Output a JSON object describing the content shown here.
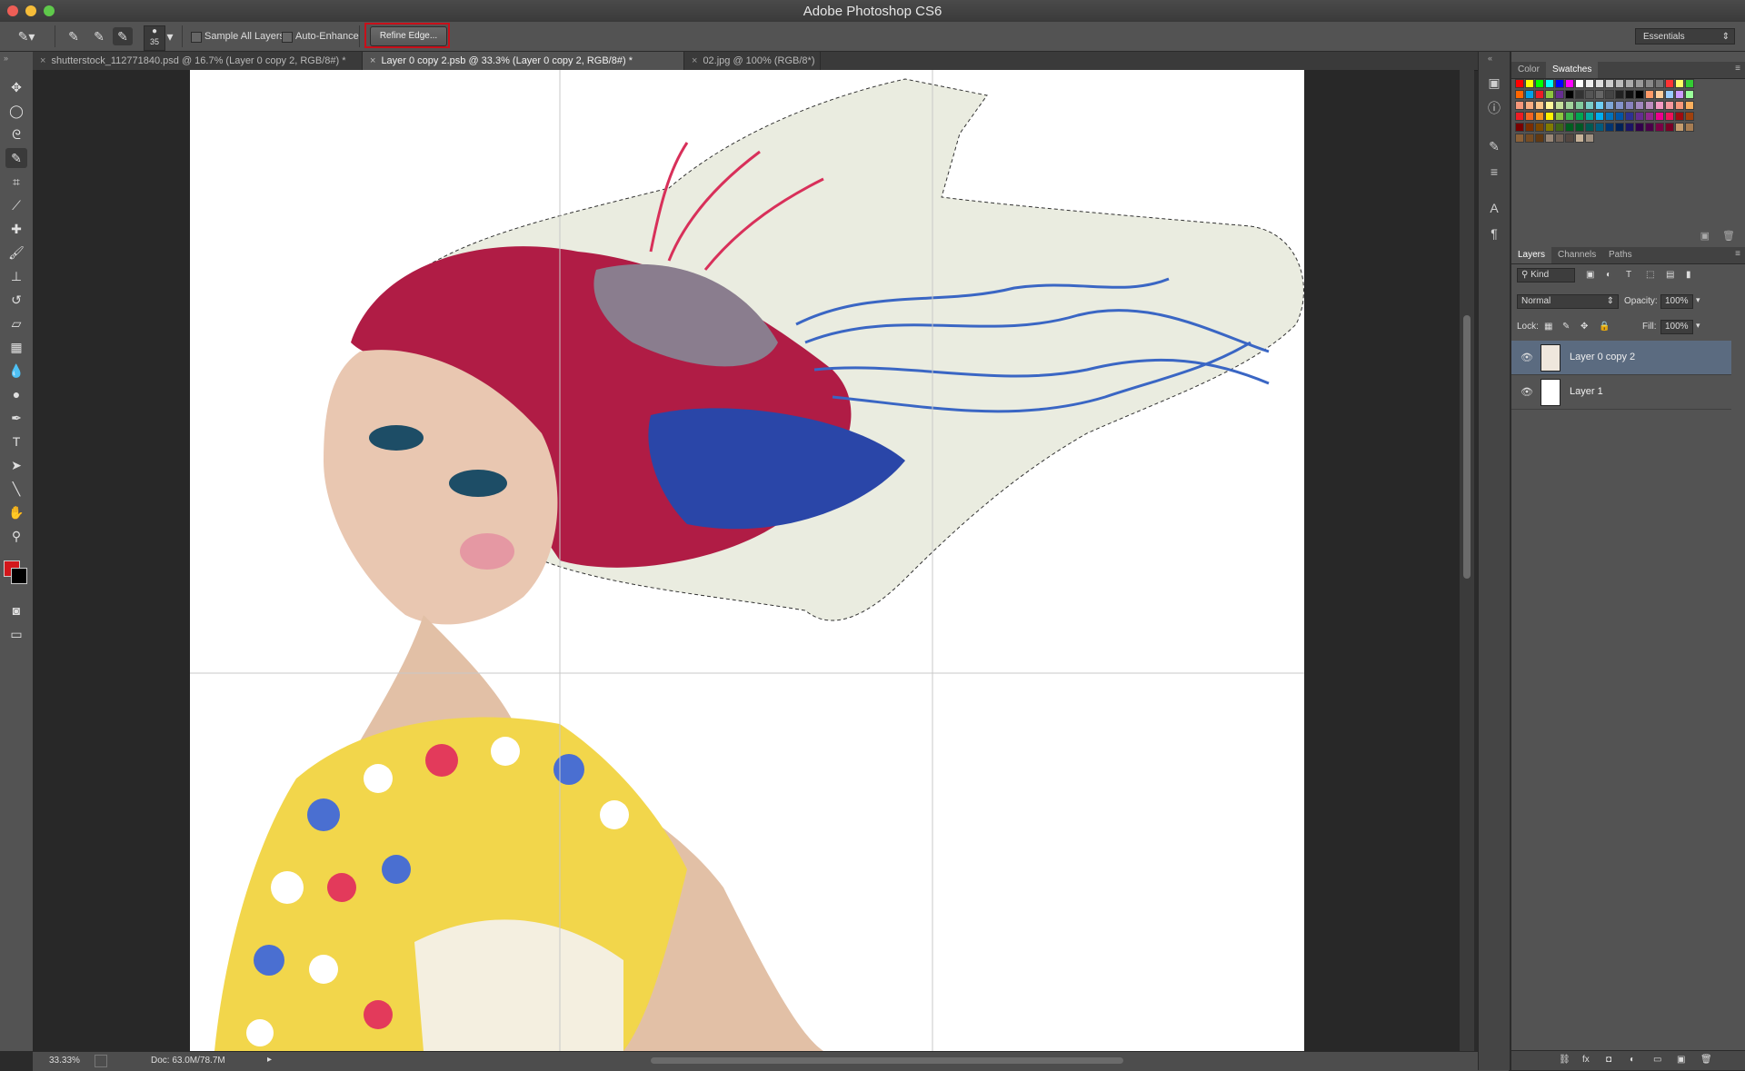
{
  "app": {
    "title": "Adobe Photoshop CS6"
  },
  "options_bar": {
    "brush_size": "35",
    "sample_all_layers_label": "Sample All Layers",
    "auto_enhance_label": "Auto-Enhance",
    "refine_edge_label": "Refine Edge...",
    "workspace": "Essentials"
  },
  "tabs": [
    {
      "label": "shutterstock_112771840.psd @ 16.7% (Layer 0 copy 2, RGB/8#) *",
      "active": false
    },
    {
      "label": "Layer 0 copy 2.psb @ 33.3% (Layer 0 copy 2, RGB/8#) *",
      "active": true
    },
    {
      "label": "02.jpg @ 100% (RGB/8*)",
      "active": false
    }
  ],
  "tools": [
    "move-tool-icon",
    "marquee-tool-icon",
    "lasso-tool-icon",
    "quick-selection-tool-icon",
    "crop-tool-icon",
    "eyedropper-tool-icon",
    "spot-healing-tool-icon",
    "brush-tool-icon",
    "clone-stamp-tool-icon",
    "history-brush-tool-icon",
    "eraser-tool-icon",
    "gradient-tool-icon",
    "blur-tool-icon",
    "dodge-tool-icon",
    "pen-tool-icon",
    "type-tool-icon",
    "path-selection-tool-icon",
    "line-tool-icon",
    "hand-tool-icon",
    "zoom-tool-icon"
  ],
  "colors": {
    "foreground": "#d3171b",
    "background": "#000000",
    "highlight": "#c8101a",
    "selected_layer": "#5b6b80"
  },
  "status": {
    "zoom": "33.33%",
    "doc_size": "Doc: 63.0M/78.7M"
  },
  "color_panel": {
    "tabs": [
      "Color",
      "Swatches"
    ],
    "active_tab": "Swatches"
  },
  "layers_panel": {
    "tabs": [
      "Layers",
      "Channels",
      "Paths"
    ],
    "active_tab": "Layers",
    "filter_label": "Kind",
    "blend_mode": "Normal",
    "opacity_label": "Opacity:",
    "opacity_value": "100%",
    "lock_label": "Lock:",
    "fill_label": "Fill:",
    "fill_value": "100%",
    "layers": [
      {
        "name": "Layer 0 copy 2",
        "selected": true
      },
      {
        "name": "Layer 1",
        "selected": false
      }
    ]
  }
}
